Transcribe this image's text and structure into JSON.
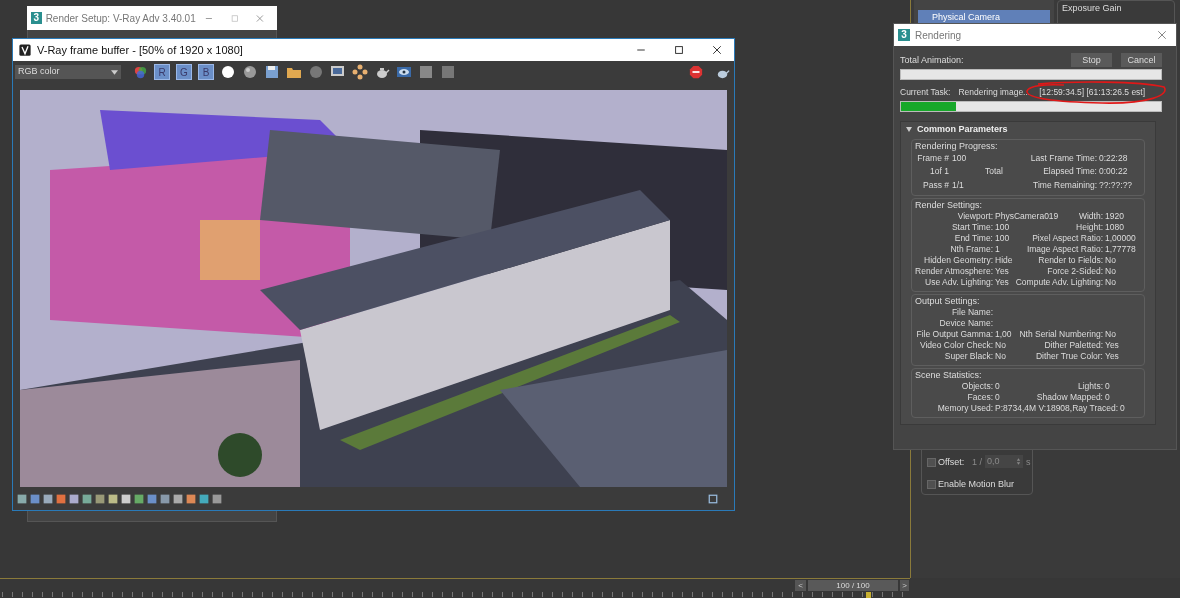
{
  "render_setup": {
    "app_icon": "3",
    "title": "Render Setup: V-Ray Adv 3.40.01"
  },
  "frame_buffer": {
    "title": "V-Ray frame buffer - [50% of 1920 x 1080]",
    "channel": "RGB color",
    "channel_buttons": [
      {
        "label": "R",
        "on": true
      },
      {
        "label": "G",
        "on": true
      },
      {
        "label": "B",
        "on": true
      }
    ]
  },
  "modifier_list": {
    "items": [
      {
        "label": "Physical Camera",
        "selected": true
      }
    ]
  },
  "exposure": {
    "title": "Exposure Gain"
  },
  "motion_blur": {
    "offset": {
      "label": "Offset:",
      "checked": false,
      "disabled": true,
      "frame": "1 /",
      "value": "0,0",
      "unit": "s"
    },
    "enable": {
      "label": "Enable Motion Blur",
      "checked": false
    }
  },
  "rendering": {
    "app_icon": "3",
    "title": "Rendering",
    "buttons": [
      "Stop",
      "Cancel"
    ],
    "total_animation": {
      "label": "Total Animation:",
      "level": 0
    },
    "current_task": {
      "label": "Current Task:",
      "text": "Rendering image...",
      "time": "[12:59:34.5] [61:13:26.5 est]",
      "level": 0.21
    },
    "section": {
      "title": "Common Parameters",
      "expanded": true,
      "groups": [
        {
          "title": "Rendering Progress:",
          "kind": "progress",
          "rows": [
            {
              "label": "Frame #",
              "value": "100",
              "right_label": "Last Frame Time:",
              "right_value": "0:22:28"
            },
            {
              "label": "1of 1",
              "note": "Total",
              "right_label": "Elapsed Time:",
              "right_value": "0:00:22"
            },
            {
              "label": "Pass #",
              "value": "1/1",
              "right_label": "Time Remaining:",
              "right_value": "??:??:??"
            }
          ]
        },
        {
          "title": "Render Settings:",
          "kind": "settings",
          "rows": [
            {
              "label": "Viewport:",
              "value": "PhysCamera019",
              "right_label": "Width:",
              "right_value": "1920"
            },
            {
              "label": "Start Time:",
              "value": "100",
              "right_label": "Height:",
              "right_value": "1080"
            },
            {
              "label": "End Time:",
              "value": "100",
              "right_label": "Pixel Aspect Ratio:",
              "right_value": "1,00000"
            },
            {
              "label": "Nth Frame:",
              "value": "1",
              "right_label": "Image Aspect Ratio:",
              "right_value": "1,77778"
            },
            {
              "label": "Hidden Geometry:",
              "value": "Hide",
              "right_label": "Render to Fields:",
              "right_value": "No"
            },
            {
              "label": "Render Atmosphere:",
              "value": "Yes",
              "right_label": "Force 2-Sided:",
              "right_value": "No"
            },
            {
              "label": "Use Adv. Lighting:",
              "value": "Yes",
              "right_label": "Compute Adv. Lighting:",
              "right_value": "No"
            }
          ]
        },
        {
          "title": "Output Settings:",
          "kind": "settings",
          "rows": [
            {
              "label": "File Name:"
            },
            {
              "label": "Device Name:"
            },
            {
              "label": "File Output Gamma:",
              "value": "1,00",
              "right_label": "Nth Serial Numbering:",
              "right_value": "No"
            },
            {
              "label": "Video Color Check:",
              "value": "No",
              "right_label": "Dither Paletted:",
              "right_value": "Yes"
            },
            {
              "label": "Super Black:",
              "value": "No",
              "right_label": "Dither True Color:",
              "right_value": "Yes"
            }
          ]
        },
        {
          "title": "Scene Statistics:",
          "kind": "settings",
          "rows": [
            {
              "label": "Objects:",
              "value": "0",
              "right_label": "Lights:",
              "right_value": "0"
            },
            {
              "label": "Faces:",
              "value": "0",
              "right_label": "Shadow Mapped:",
              "right_value": "0"
            },
            {
              "label": "Memory Used:",
              "value": "P:8734,4M V:18908,",
              "right_label": "Ray Traced:",
              "right_value": "0"
            }
          ]
        }
      ]
    }
  },
  "timeline": {
    "prev": "<",
    "frame": "100 / 100",
    "next": ">"
  }
}
